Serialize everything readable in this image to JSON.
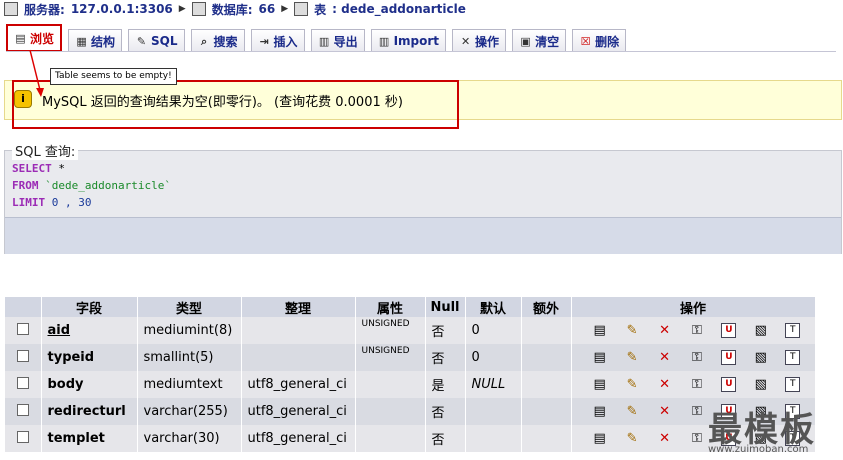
{
  "breadcrumb": {
    "server_label": "服务器:",
    "server_value": "127.0.0.1:3306",
    "database_label": "数据库:",
    "database_value": "66",
    "table_label": "表",
    "table_value": ": dede_addonarticle"
  },
  "tabs": [
    {
      "label": "浏览",
      "icon": "browse-icon",
      "active": true
    },
    {
      "label": "结构",
      "icon": "structure-icon"
    },
    {
      "label": "SQL",
      "icon": "sql-icon"
    },
    {
      "label": "搜索",
      "icon": "search-icon"
    },
    {
      "label": "插入",
      "icon": "insert-icon"
    },
    {
      "label": "导出",
      "icon": "export-icon"
    },
    {
      "label": "Import",
      "icon": "import-icon"
    },
    {
      "label": "操作",
      "icon": "operations-icon"
    },
    {
      "label": "清空",
      "icon": "empty-icon"
    },
    {
      "label": "删除",
      "icon": "drop-icon"
    }
  ],
  "tooltip": "Table seems to be empty!",
  "notice": {
    "message": "MySQL 返回的查询结果为空(即零行)。 (查询花费  0.0001 秒)"
  },
  "sql": {
    "legend": "SQL 查询:",
    "line1_kw": "SELECT",
    "line1_rest": " *",
    "line2_kw": "FROM",
    "line2_rest": " `dede_addonarticle`",
    "line3_kw": "LIMIT",
    "line3_rest": " 0 , 30"
  },
  "table": {
    "headers": [
      "字段",
      "类型",
      "整理",
      "属性",
      "Null",
      "默认",
      "额外",
      "操作"
    ],
    "rows": [
      {
        "field": "aid",
        "type": "mediumint(8)",
        "collation": "",
        "attr": "UNSIGNED",
        "null": "否",
        "default": "0",
        "extra": "",
        "primary": true
      },
      {
        "field": "typeid",
        "type": "smallint(5)",
        "collation": "",
        "attr": "UNSIGNED",
        "null": "否",
        "default": "0",
        "extra": ""
      },
      {
        "field": "body",
        "type": "mediumtext",
        "collation": "utf8_general_ci",
        "attr": "",
        "null": "是",
        "default": "NULL",
        "extra": ""
      },
      {
        "field": "redirecturl",
        "type": "varchar(255)",
        "collation": "utf8_general_ci",
        "attr": "",
        "null": "否",
        "default": "",
        "extra": ""
      },
      {
        "field": "templet",
        "type": "varchar(30)",
        "collation": "utf8_general_ci",
        "attr": "",
        "null": "否",
        "default": "",
        "extra": ""
      }
    ]
  },
  "watermark": {
    "text": "最模板",
    "url": "www.zuimoban.com"
  }
}
